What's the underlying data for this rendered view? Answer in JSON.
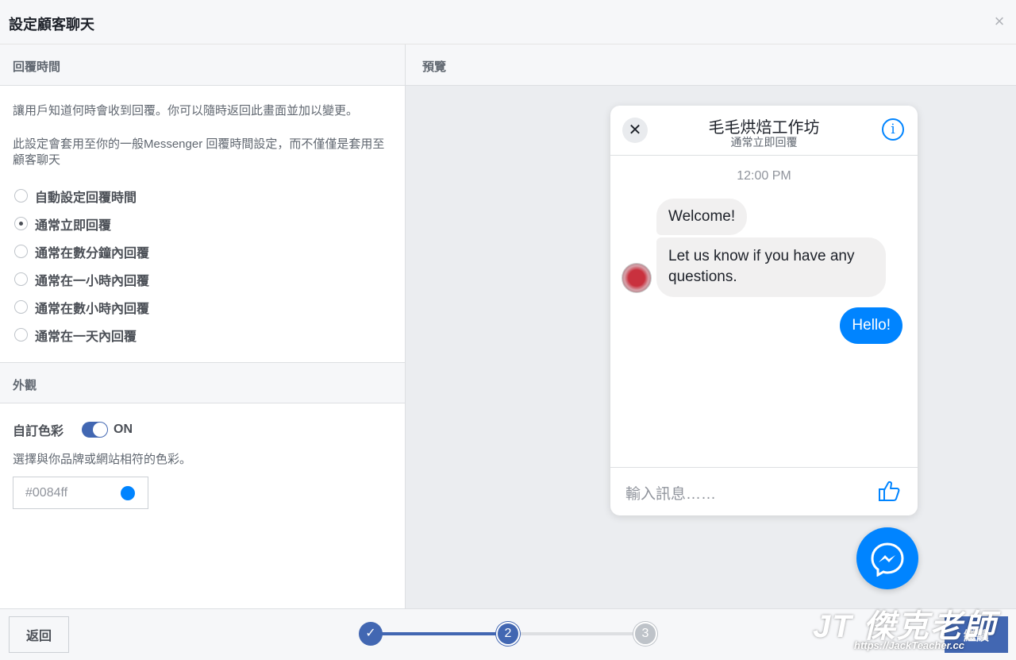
{
  "dialog": {
    "title": "設定顧客聊天",
    "close_glyph": "×"
  },
  "response_time": {
    "heading": "回覆時間",
    "desc1": "讓用戶知道何時會收到回覆。你可以隨時返回此畫面並加以變更。",
    "desc2": "此設定會套用至你的一般Messenger 回覆時間設定，而不僅僅是套用至顧客聊天",
    "options": [
      {
        "label": "自動設定回覆時間",
        "selected": false
      },
      {
        "label": "通常立即回覆",
        "selected": true
      },
      {
        "label": "通常在數分鐘內回覆",
        "selected": false
      },
      {
        "label": "通常在一小時內回覆",
        "selected": false
      },
      {
        "label": "通常在數小時內回覆",
        "selected": false
      },
      {
        "label": "通常在一天內回覆",
        "selected": false
      }
    ]
  },
  "appearance": {
    "heading": "外觀",
    "custom_color_label": "自訂色彩",
    "toggle_state": "ON",
    "desc": "選擇與你品牌或網站相符的色彩。",
    "color_value": "#0084ff",
    "accent": "#0084ff"
  },
  "preview": {
    "heading": "預覽",
    "page_name": "毛毛烘焙工作坊",
    "status": "通常立即回覆",
    "time": "12:00 PM",
    "msg_in_1": "Welcome!",
    "msg_in_2": "Let us know if you have any questions.",
    "msg_out": "Hello!",
    "input_placeholder": "輸入訊息……",
    "icons": {
      "close": "close-icon",
      "info": "info-icon",
      "like": "thumbs-up-icon",
      "messenger": "messenger-icon"
    }
  },
  "footer": {
    "back_label": "返回",
    "next_label": "繼續",
    "steps": [
      {
        "label": "✓",
        "state": "done"
      },
      {
        "label": "2",
        "state": "current"
      },
      {
        "label": "3",
        "state": "todo"
      }
    ]
  },
  "watermark": {
    "logo": "JT 傑克老師",
    "url": "https://JackTeacher.cc"
  }
}
